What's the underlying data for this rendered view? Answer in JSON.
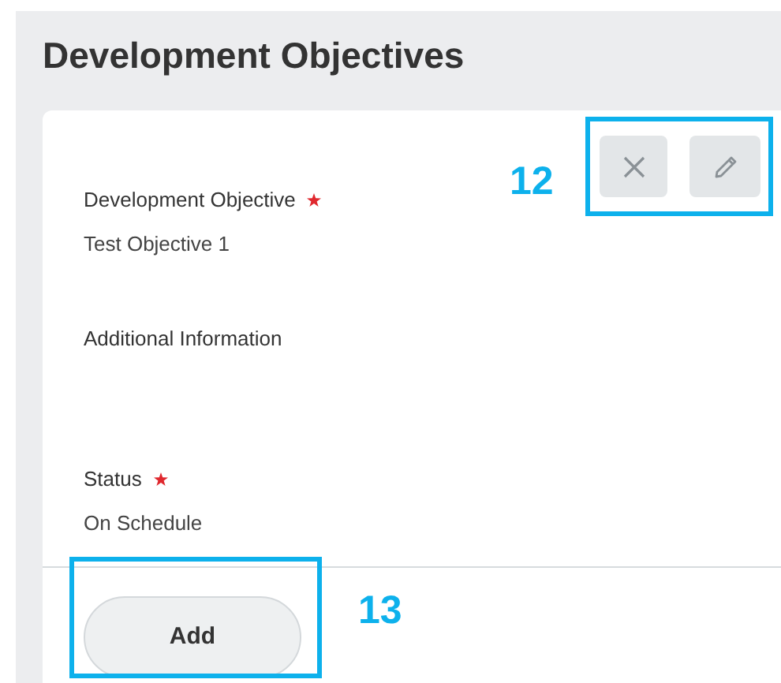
{
  "page_title": "Development Objectives",
  "fields": [
    {
      "label": "Development Objective",
      "required": true,
      "value": "Test Objective 1"
    },
    {
      "label": "Additional Information",
      "required": false
    },
    {
      "label": "Status",
      "required": true,
      "value": "On Schedule"
    }
  ],
  "add_button": "Add",
  "callouts": [
    {
      "label": "12",
      "kind": "icons"
    },
    {
      "label": "13",
      "kind": "add"
    }
  ]
}
